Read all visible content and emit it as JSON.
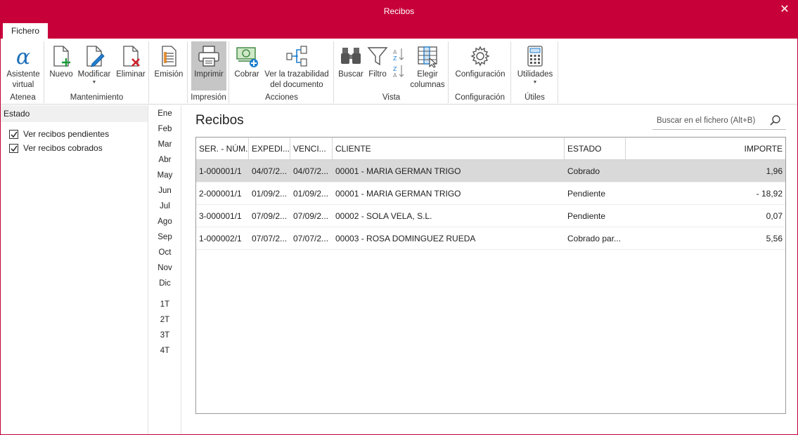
{
  "window": {
    "title": "Recibos",
    "close_glyph": "✕"
  },
  "tabs": [
    {
      "label": "Fichero"
    }
  ],
  "ribbon": {
    "groups": {
      "atenea": "Atenea",
      "mantenimiento": "Mantenimiento",
      "impresion": "Impresión",
      "acciones": "Acciones",
      "vista": "Vista",
      "configuracion": "Configuración",
      "utiles": "Útiles"
    },
    "buttons": {
      "asistente_1": "Asistente",
      "asistente_2": "virtual",
      "nuevo": "Nuevo",
      "modificar": "Modificar",
      "eliminar": "Eliminar",
      "emision": "Emisión",
      "imprimir": "Imprimir",
      "cobrar": "Cobrar",
      "trazabilidad_1": "Ver la trazabilidad",
      "trazabilidad_2": "del documento",
      "buscar": "Buscar",
      "filtro": "Filtro",
      "elegir_1": "Elegir",
      "elegir_2": "columnas",
      "configuracion": "Configuración",
      "utilidades": "Utilidades"
    },
    "icons": {
      "asistente": "alpha-icon",
      "nuevo": "new-document-icon",
      "modificar": "edit-document-icon",
      "eliminar": "delete-document-icon",
      "emision": "document-list-icon",
      "imprimir": "printer-icon",
      "cobrar": "money-add-icon",
      "trazabilidad": "flow-chart-icon",
      "buscar": "binoculars-icon",
      "filtro": "filter-icon",
      "ordenar": "sort-az-icon",
      "elegir": "choose-columns-icon",
      "configuracion": "gear-icon",
      "utilidades": "calculator-icon"
    }
  },
  "left_panel": {
    "header": "Estado",
    "filters": [
      {
        "label": "Ver recibos pendientes",
        "checked": true
      },
      {
        "label": "Ver recibos cobrados",
        "checked": true
      }
    ]
  },
  "months": [
    "Ene",
    "Feb",
    "Mar",
    "Abr",
    "May",
    "Jun",
    "Jul",
    "Ago",
    "Sep",
    "Oct",
    "Nov",
    "Dic"
  ],
  "quarters": [
    "1T",
    "2T",
    "3T",
    "4T"
  ],
  "main": {
    "title": "Recibos",
    "search_placeholder": "Buscar en el fichero (Alt+B)"
  },
  "table": {
    "columns": [
      "SER. - NÚM.",
      "EXPEDI...",
      "VENCI...",
      "CLIENTE",
      "ESTADO",
      "IMPORTE"
    ],
    "rows": [
      {
        "num": "1-000001/1",
        "exp": "04/07/2...",
        "ven": "04/07/2...",
        "cliente": "00001 - MARIA GERMAN TRIGO",
        "estado": "Cobrado",
        "importe": "1,96"
      },
      {
        "num": "2-000001/1",
        "exp": "01/09/2...",
        "ven": "01/09/2...",
        "cliente": "00001 - MARIA GERMAN TRIGO",
        "estado": "Pendiente",
        "importe": "- 18,92"
      },
      {
        "num": "3-000001/1",
        "exp": "07/09/2...",
        "ven": "07/09/2...",
        "cliente": "00002 - SOLA VELA, S.L.",
        "estado": "Pendiente",
        "importe": "0,07"
      },
      {
        "num": "1-000002/1",
        "exp": "07/07/2...",
        "ven": "07/07/2...",
        "cliente": "00003 - ROSA DOMINGUEZ RUEDA",
        "estado": "Cobrado par...",
        "importe": "5,56"
      }
    ]
  },
  "colors": {
    "brand": "#c8003a",
    "selected_row": "#d9d9d9",
    "active_button": "#c6c6c6",
    "accent_green": "#1a9a3a",
    "accent_red": "#d0202a",
    "accent_blue": "#1e7fd0"
  }
}
